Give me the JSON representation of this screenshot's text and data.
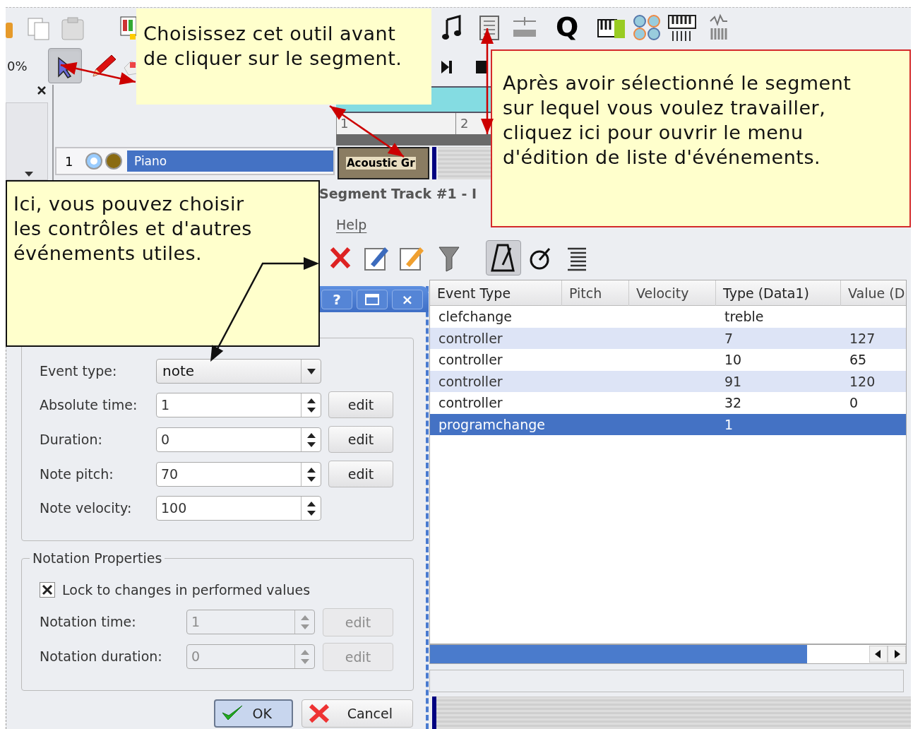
{
  "app_toolbar": {
    "zoom": "0%",
    "quantize": "Q",
    "tools": [
      {
        "kind": "select",
        "selected": true
      },
      {
        "kind": "pencil",
        "selected": false
      }
    ]
  },
  "ruler": [
    "1",
    "2"
  ],
  "track": {
    "number": "1",
    "name": "Piano",
    "selected": true,
    "segment": "Acoustic Gr"
  },
  "event_editor": {
    "title": "Segment Track #1 - I",
    "menu": [
      "Help"
    ],
    "metronome_on": true,
    "columns": [
      "Event Type",
      "Pitch",
      "Velocity",
      "Type (Data1)",
      "Value (D"
    ],
    "rows": [
      {
        "event_type": "clefchange",
        "data1": "treble",
        "selected": false
      },
      {
        "event_type": "controller",
        "data1": "7",
        "value": "127",
        "selected": false
      },
      {
        "event_type": "controller",
        "data1": "10",
        "value": "65",
        "selected": false
      },
      {
        "event_type": "controller",
        "data1": "91",
        "value": "120",
        "selected": false
      },
      {
        "event_type": "controller",
        "data1": "32",
        "value": "0",
        "selected": false
      },
      {
        "event_type": "programchange",
        "data1": "1",
        "selected": true
      }
    ]
  },
  "dialog": {
    "title_buttons": [
      {
        "kind": "help",
        "label": "?"
      },
      {
        "kind": "maximize"
      },
      {
        "kind": "close",
        "label": "×"
      }
    ],
    "fields": [
      {
        "kind": "combo",
        "label": "Event type:",
        "value": "note"
      },
      {
        "kind": "spin",
        "label": "Absolute time:",
        "value": "1",
        "button": "edit"
      },
      {
        "kind": "spin",
        "label": "Duration:",
        "value": "0",
        "button": "edit"
      },
      {
        "kind": "spin",
        "label": "Note pitch:",
        "value": "70",
        "button": "edit"
      },
      {
        "kind": "spin",
        "label": "Note velocity:",
        "value": "100"
      }
    ],
    "notation": {
      "title": "Notation Properties",
      "lock": {
        "label": "Lock to changes in performed values",
        "checked": true
      },
      "fields": [
        {
          "label": "Notation time:",
          "value": "1",
          "button": "edit",
          "disabled": true
        },
        {
          "label": "Notation duration:",
          "value": "0",
          "button": "edit",
          "disabled": true
        }
      ]
    },
    "buttons": [
      {
        "kind": "ok",
        "label": "OK"
      },
      {
        "kind": "cancel",
        "label": "Cancel"
      }
    ]
  },
  "callouts": [
    {
      "text": "Choisissez cet outil avant\nde cliquer sur le segment."
    },
    {
      "text": "Après avoir sélectionné le segment\nsur lequel vous voulez travailler,\ncliquez ici pour ouvrir le menu\nd'édition de liste d'événements."
    },
    {
      "text": "Ici, vous pouvez choisir\nles contrôles et d'autres\névénements utiles."
    }
  ]
}
